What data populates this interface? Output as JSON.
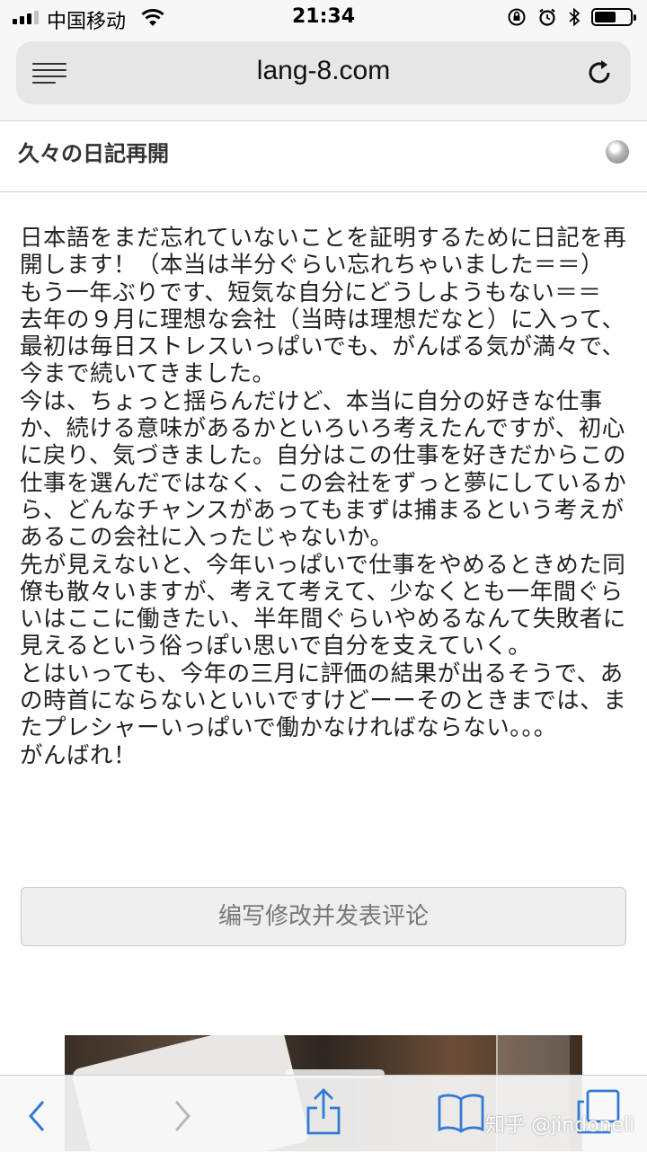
{
  "status_bar": {
    "carrier": "中国移动",
    "time": "21:34",
    "signal_bars_filled": 3,
    "battery_level": 0.6,
    "icons": [
      "signal-icon",
      "wifi-icon",
      "orientation-lock-icon",
      "alarm-icon",
      "bluetooth-icon",
      "battery-icon"
    ]
  },
  "browser": {
    "url": "lang-8.com",
    "icons": [
      "menu-icon",
      "reload-icon"
    ]
  },
  "post": {
    "title": "久々の日記再開",
    "globe_icon": "globe-icon",
    "body": "日本語をまだ忘れていないことを証明するために日記を再開します！（本当は半分ぐらい忘れちゃいました＝＝）\nもう一年ぶりです、短気な自分にどうしようもない＝＝\n去年の９月に理想な会社（当時は理想だなと）に入って、最初は毎日ストレスいっぱいでも、がんばる気が満々で、今まで続いてきました。\n今は、ちょっと揺らんだけど、本当に自分の好きな仕事か、続ける意味があるかといろいろ考えたんですが、初心に戻り、気づきました。自分はこの仕事を好きだからこの仕事を選んだではなく、この会社をずっと夢にしているから、どんなチャンスがあってもまずは捕まるという考えがあるこの会社に入ったじゃないか。\n先が見えないと、今年いっぱいで仕事をやめるときめた同僚も散々いますが、考えて考えて、少なくとも一年間ぐらいはここに働きたい、半年間ぐらいやめるなんて失敗者に見えるという俗っぽい思いで自分を支えていく。\nとはいっても、今年の三月に評価の結果が出るそうで、あの時首にならないといいですけどーーそのときまでは、またプレシャーいっぱいで働かなければならない。。。\nがんばれ！",
    "edit_button_label": "编写修改并发表评论"
  },
  "toolbar": {
    "icons": [
      "back-icon",
      "forward-icon",
      "share-icon",
      "bookmarks-icon",
      "tabs-icon"
    ],
    "watermark": "知乎 @jindoneli"
  },
  "colors": {
    "accent": "#2f7bd6",
    "chrome_bg": "#f7f7f7",
    "urlbar_bg": "#e6e6e6",
    "button_bg": "#eeeeee"
  }
}
